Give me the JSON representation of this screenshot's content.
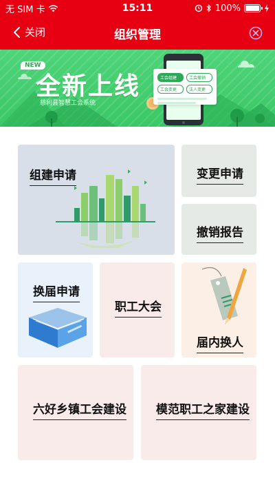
{
  "status": {
    "carrier": "无 SIM 卡",
    "time": "15:11",
    "battery_pct_label": "100%",
    "battery_level": 1.0
  },
  "nav": {
    "back_label": "关闭",
    "title": "组织管理"
  },
  "banner": {
    "badge": "NEW",
    "headline": "全新上线",
    "subtitle": "慈利县智慧工会系统",
    "tags": [
      "工会组建",
      "工会撤销",
      "工会变更",
      "法人变更"
    ]
  },
  "cards": {
    "build": "组建申请",
    "change": "变更申请",
    "revoke": "撤销报告",
    "reelect": "换届申请",
    "congress": "职工大会",
    "inner": "届内换人",
    "six": "六好乡镇工会建设",
    "model": "模范职工之家建设"
  },
  "colors": {
    "header_red": "#e60012",
    "banner_green": "#3ac865"
  },
  "icons": {
    "back": "chevron-left-icon",
    "close": "close-circle-icon",
    "wifi": "wifi-icon",
    "alarm": "alarm-icon",
    "bluetooth": "bluetooth-icon",
    "charging": "charging-bolt-icon"
  }
}
